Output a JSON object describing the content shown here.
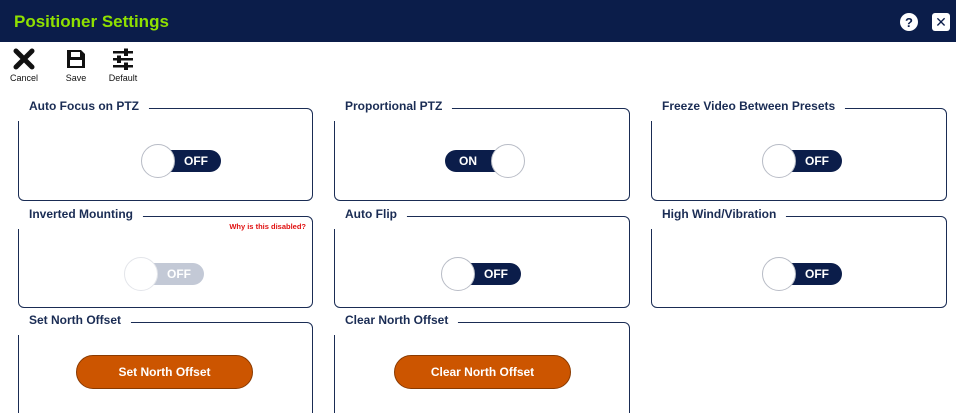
{
  "window": {
    "title": "Positioner Settings",
    "help_label": "?",
    "close_label": "✕"
  },
  "toolbar": {
    "cancel_label": "Cancel",
    "save_label": "Save",
    "default_label": "Default"
  },
  "settings": [
    {
      "label": "Auto Focus on PTZ",
      "type": "toggle",
      "state": "OFF",
      "enabled": true
    },
    {
      "label": "Proportional PTZ",
      "type": "toggle",
      "state": "ON",
      "enabled": true
    },
    {
      "label": "Freeze Video Between Presets",
      "type": "toggle",
      "state": "OFF",
      "enabled": true
    },
    {
      "label": "Inverted Mounting",
      "type": "toggle",
      "state": "OFF",
      "enabled": false,
      "note": "Why is this disabled?"
    },
    {
      "label": "Auto Flip",
      "type": "toggle",
      "state": "OFF",
      "enabled": true
    },
    {
      "label": "High Wind/Vibration",
      "type": "toggle",
      "state": "OFF",
      "enabled": true
    },
    {
      "label": "Set North Offset",
      "type": "button",
      "button_label": "Set North Offset"
    },
    {
      "label": "Clear North Offset",
      "type": "button",
      "button_label": "Clear North Offset"
    }
  ],
  "colors": {
    "titlebar": "#0b1d4a",
    "title_text": "#8fe000",
    "toggle_active": "#0b1d4a",
    "toggle_disabled": "#c3c9d6",
    "action_button": "#cc5500",
    "note_text": "#e01010"
  }
}
